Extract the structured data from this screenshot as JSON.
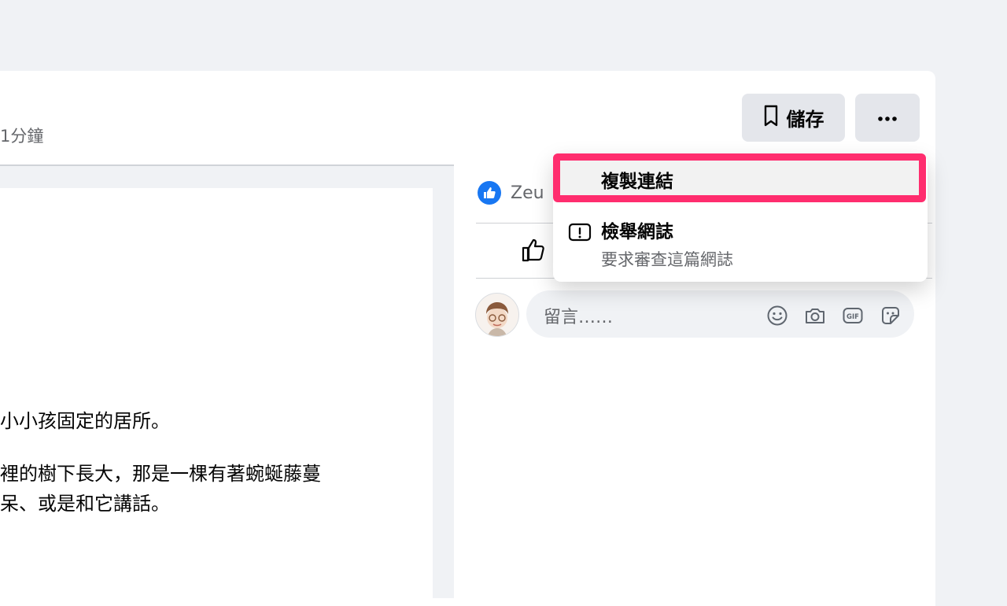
{
  "post": {
    "time": "1分鐘"
  },
  "toolbar": {
    "save_label": "儲存"
  },
  "article": {
    "lines": [
      "小小孩固定的居所。",
      "裡的樹下長大，那是一棵有著蜿蜒藤蔓",
      "呆、或是和它講話。"
    ]
  },
  "reactions": {
    "name": "Zeu"
  },
  "comment": {
    "placeholder": "留言……",
    "icons": [
      "emoji-icon",
      "camera-icon",
      "gif-icon",
      "sticker-icon"
    ]
  },
  "menu": {
    "copy_link": "複製連結",
    "report_title": "檢舉網誌",
    "report_desc": "要求審查這篇網誌"
  },
  "colors": {
    "highlight": "#ff2d6e",
    "like_blue": "#1877f2",
    "button_gray": "#e4e6eb",
    "background": "#f0f2f5"
  }
}
